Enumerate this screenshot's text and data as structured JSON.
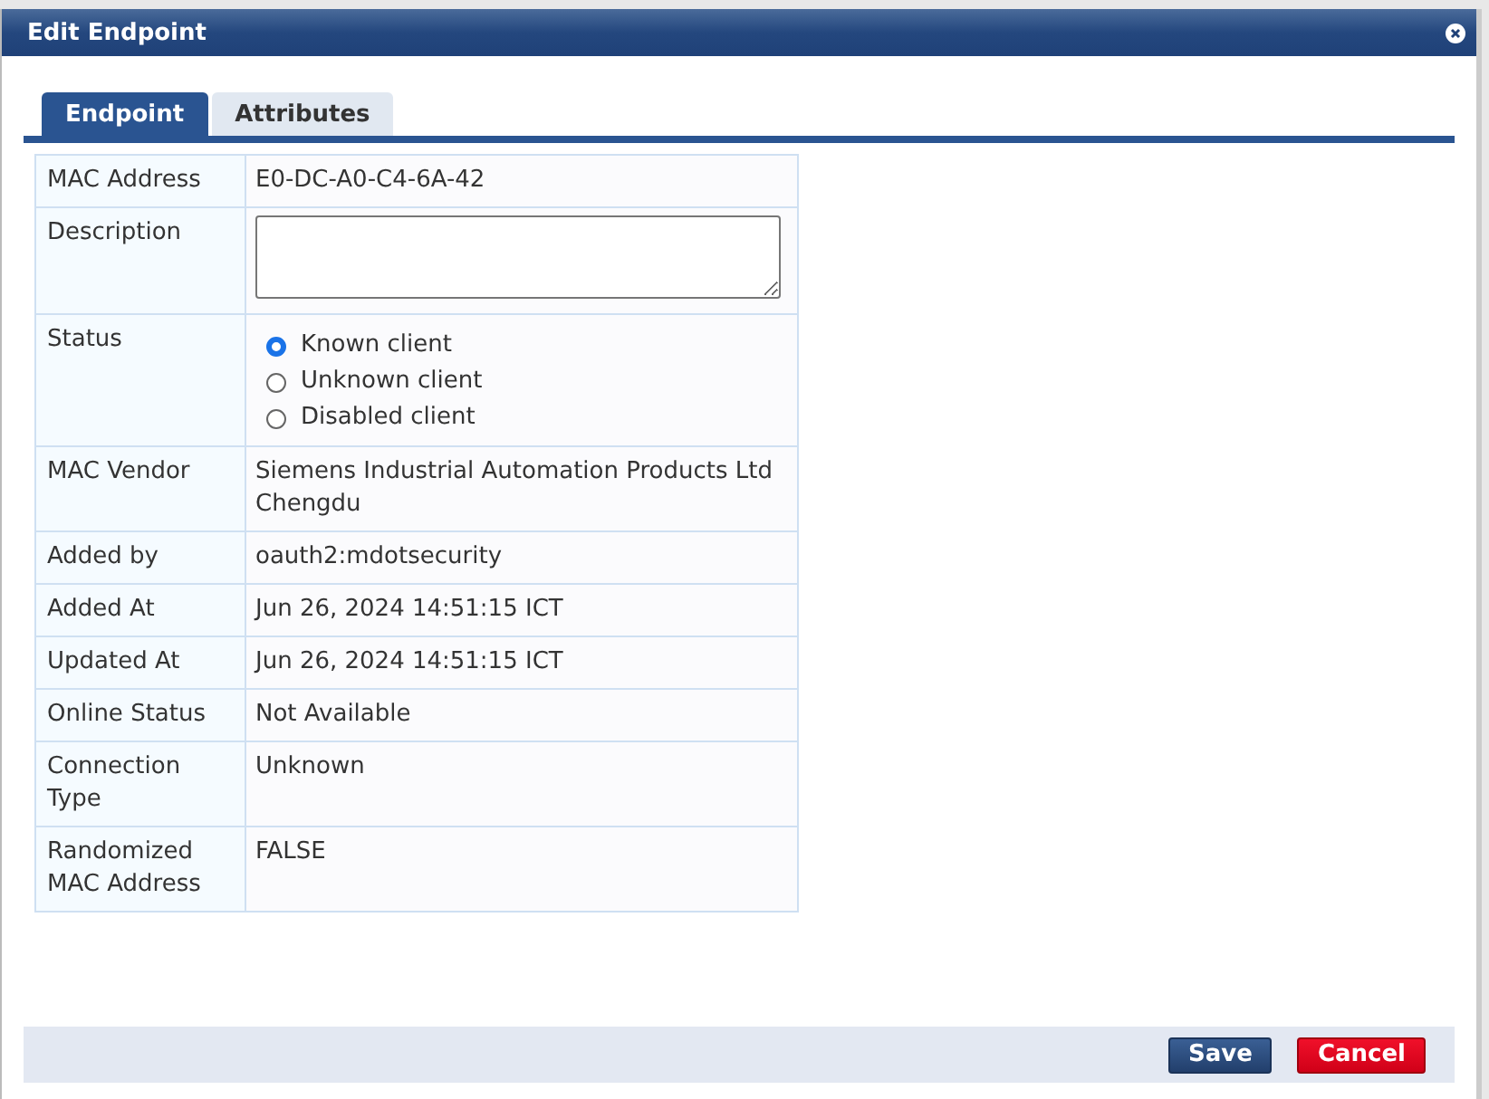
{
  "window": {
    "title": "Edit Endpoint"
  },
  "tabs": [
    {
      "label": "Endpoint",
      "selected": true
    },
    {
      "label": "Attributes",
      "selected": false
    }
  ],
  "rows": [
    {
      "kind": "text",
      "label": "MAC Address",
      "value": "E0-DC-A0-C4-6A-42"
    },
    {
      "kind": "textarea",
      "label": "Description"
    },
    {
      "kind": "radio",
      "label": "Status",
      "options": [
        {
          "label": "Known client",
          "selected": true
        },
        {
          "label": "Unknown client",
          "selected": false
        },
        {
          "label": "Disabled client",
          "selected": false
        }
      ]
    },
    {
      "kind": "text",
      "label": "MAC Vendor",
      "value": "Siemens Industrial Automation Products Ltd Chengdu"
    },
    {
      "kind": "text",
      "label": "Added by",
      "value": "oauth2:mdotsecurity"
    },
    {
      "kind": "text",
      "label": "Added At",
      "value": "Jun 26, 2024 14:51:15 ICT"
    },
    {
      "kind": "text",
      "label": "Updated At",
      "value": "Jun 26, 2024 14:51:15 ICT"
    },
    {
      "kind": "text",
      "label": "Online Status",
      "value": "Not Available"
    },
    {
      "kind": "text",
      "label": "Connection Type",
      "value": "Unknown"
    },
    {
      "kind": "text",
      "label": "Randomized MAC Address",
      "value": "FALSE"
    }
  ],
  "buttons": [
    {
      "kind": "primary",
      "label": "Save"
    },
    {
      "kind": "danger",
      "label": "Cancel"
    }
  ]
}
